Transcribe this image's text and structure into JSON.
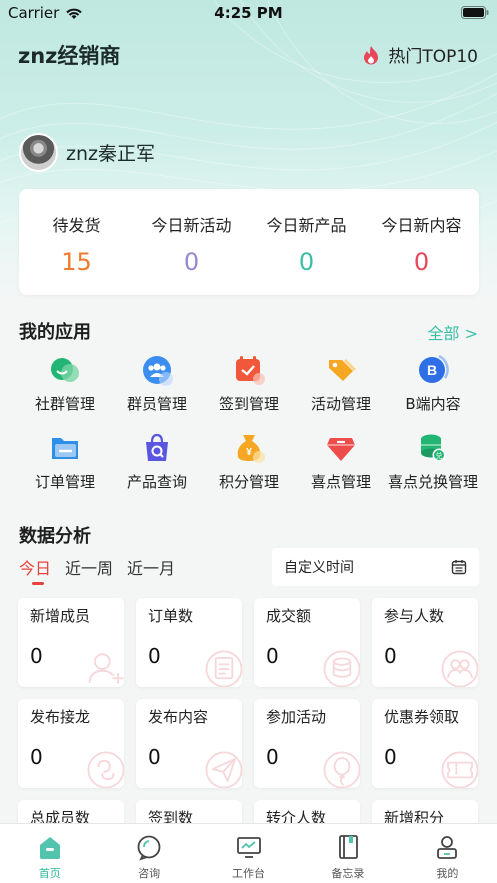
{
  "status_bar": {
    "carrier": "Carrier",
    "time": "4:25 PM"
  },
  "header": {
    "app_title": "znz经销商",
    "hot_label": "热门TOP10"
  },
  "user": {
    "name": "znz秦正军"
  },
  "stats": [
    {
      "label": "待发货",
      "value": "15",
      "color": "#f07b2f"
    },
    {
      "label": "今日新活动",
      "value": "0",
      "color": "#9a86d6"
    },
    {
      "label": "今日新产品",
      "value": "0",
      "color": "#3cbfa6"
    },
    {
      "label": "今日新内容",
      "value": "0",
      "color": "#e8475a"
    }
  ],
  "apps_section": {
    "title": "我的应用",
    "see_all": "全部 >"
  },
  "apps": [
    {
      "label": "社群管理",
      "icon": "community-icon",
      "color": "#22b573"
    },
    {
      "label": "群员管理",
      "icon": "members-icon",
      "color": "#3b8ef0"
    },
    {
      "label": "签到管理",
      "icon": "calendar-check-icon",
      "color": "#f0573b"
    },
    {
      "label": "活动管理",
      "icon": "tags-icon",
      "color": "#f5a623"
    },
    {
      "label": "B端内容",
      "icon": "b-circle-icon",
      "color": "#2e6fe6"
    },
    {
      "label": "订单管理",
      "icon": "order-folder-icon",
      "color": "#2e8fe6"
    },
    {
      "label": "产品查询",
      "icon": "shopping-bag-search-icon",
      "color": "#5b56e0"
    },
    {
      "label": "积分管理",
      "icon": "money-bag-icon",
      "color": "#f5a623"
    },
    {
      "label": "喜点管理",
      "icon": "gem-icon",
      "color": "#ee4b4b"
    },
    {
      "label": "喜点兑换管理",
      "icon": "coins-exchange-icon",
      "color": "#22b573"
    }
  ],
  "analysis_section": {
    "title": "数据分析",
    "custom_time": "自定义时间"
  },
  "time_tabs": [
    "今日",
    "近一周",
    "近一月"
  ],
  "metrics": [
    {
      "label": "新增成员",
      "value": "0",
      "icon": "add-user-icon"
    },
    {
      "label": "订单数",
      "value": "0",
      "icon": "order-doc-icon"
    },
    {
      "label": "成交额",
      "value": "0",
      "icon": "coin-stack-icon"
    },
    {
      "label": "参与人数",
      "value": "0",
      "icon": "people-icon"
    },
    {
      "label": "发布接龙",
      "value": "0",
      "icon": "chain-icon"
    },
    {
      "label": "发布内容",
      "value": "0",
      "icon": "send-icon"
    },
    {
      "label": "参加活动",
      "value": "0",
      "icon": "balloon-icon"
    },
    {
      "label": "优惠券领取",
      "value": "0",
      "icon": "coupon-icon"
    },
    {
      "label": "总成员数",
      "value": "",
      "icon": ""
    },
    {
      "label": "签到数",
      "value": "",
      "icon": ""
    },
    {
      "label": "转介人数",
      "value": "",
      "icon": ""
    },
    {
      "label": "新增积分",
      "value": "",
      "icon": ""
    }
  ],
  "bottom_nav": [
    {
      "label": "首页",
      "icon": "home-icon"
    },
    {
      "label": "咨询",
      "icon": "chat-icon"
    },
    {
      "label": "工作台",
      "icon": "monitor-icon"
    },
    {
      "label": "备忘录",
      "icon": "notebook-icon"
    },
    {
      "label": "我的",
      "icon": "profile-icon"
    }
  ],
  "colors": {
    "accent": "#3cbfa6",
    "active_tab": "#e8413e",
    "metric_icon": "#f6d3d6"
  }
}
